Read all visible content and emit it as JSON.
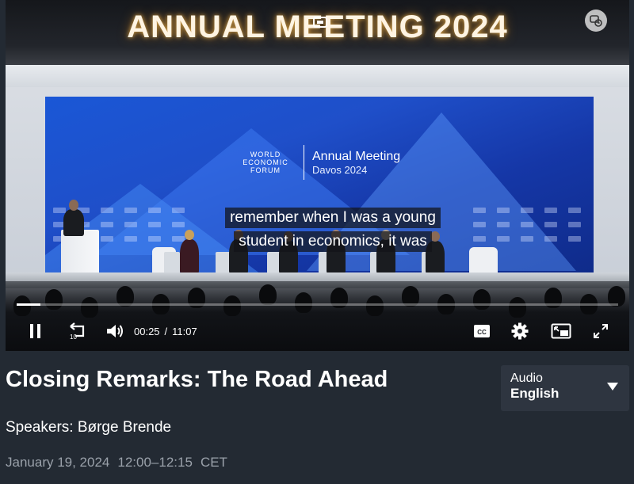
{
  "video": {
    "banner_text": "ANNUAL MEETING 2024",
    "screen_logo": {
      "org_line1": "WORLD",
      "org_line2": "ECONOMIC",
      "org_line3": "FORUM",
      "event_line1": "Annual Meeting",
      "event_line2": "Davos 2024"
    },
    "subtitles": [
      "remember when I was a young",
      "student in economics, it was"
    ],
    "controls": {
      "current_time": "00:25",
      "separator": "/",
      "duration": "11:07",
      "rewind_seconds": "10",
      "cc_label": "CC",
      "progress_fraction": 0.04
    }
  },
  "session": {
    "title": "Closing Remarks: The Road Ahead",
    "speakers": "Speakers: Børge Brende",
    "date": "January 19, 2024",
    "time": "12:00–12:15",
    "timezone": "CET"
  },
  "audio": {
    "label": "Audio",
    "value": "English"
  },
  "icons": {
    "pause": "pause-icon",
    "rewind": "rewind-10-icon",
    "volume": "volume-icon",
    "captions": "captions-icon",
    "settings": "gear-icon",
    "pip": "picture-in-picture-icon",
    "fullscreen": "fullscreen-icon",
    "collab": "collaboration-icon",
    "caret": "chevron-down-icon"
  },
  "colors": {
    "page_bg": "#232a33",
    "screen_blue": "#1f4fc9",
    "secondary_text": "#9aa1aa",
    "select_bg": "#2e3540"
  }
}
